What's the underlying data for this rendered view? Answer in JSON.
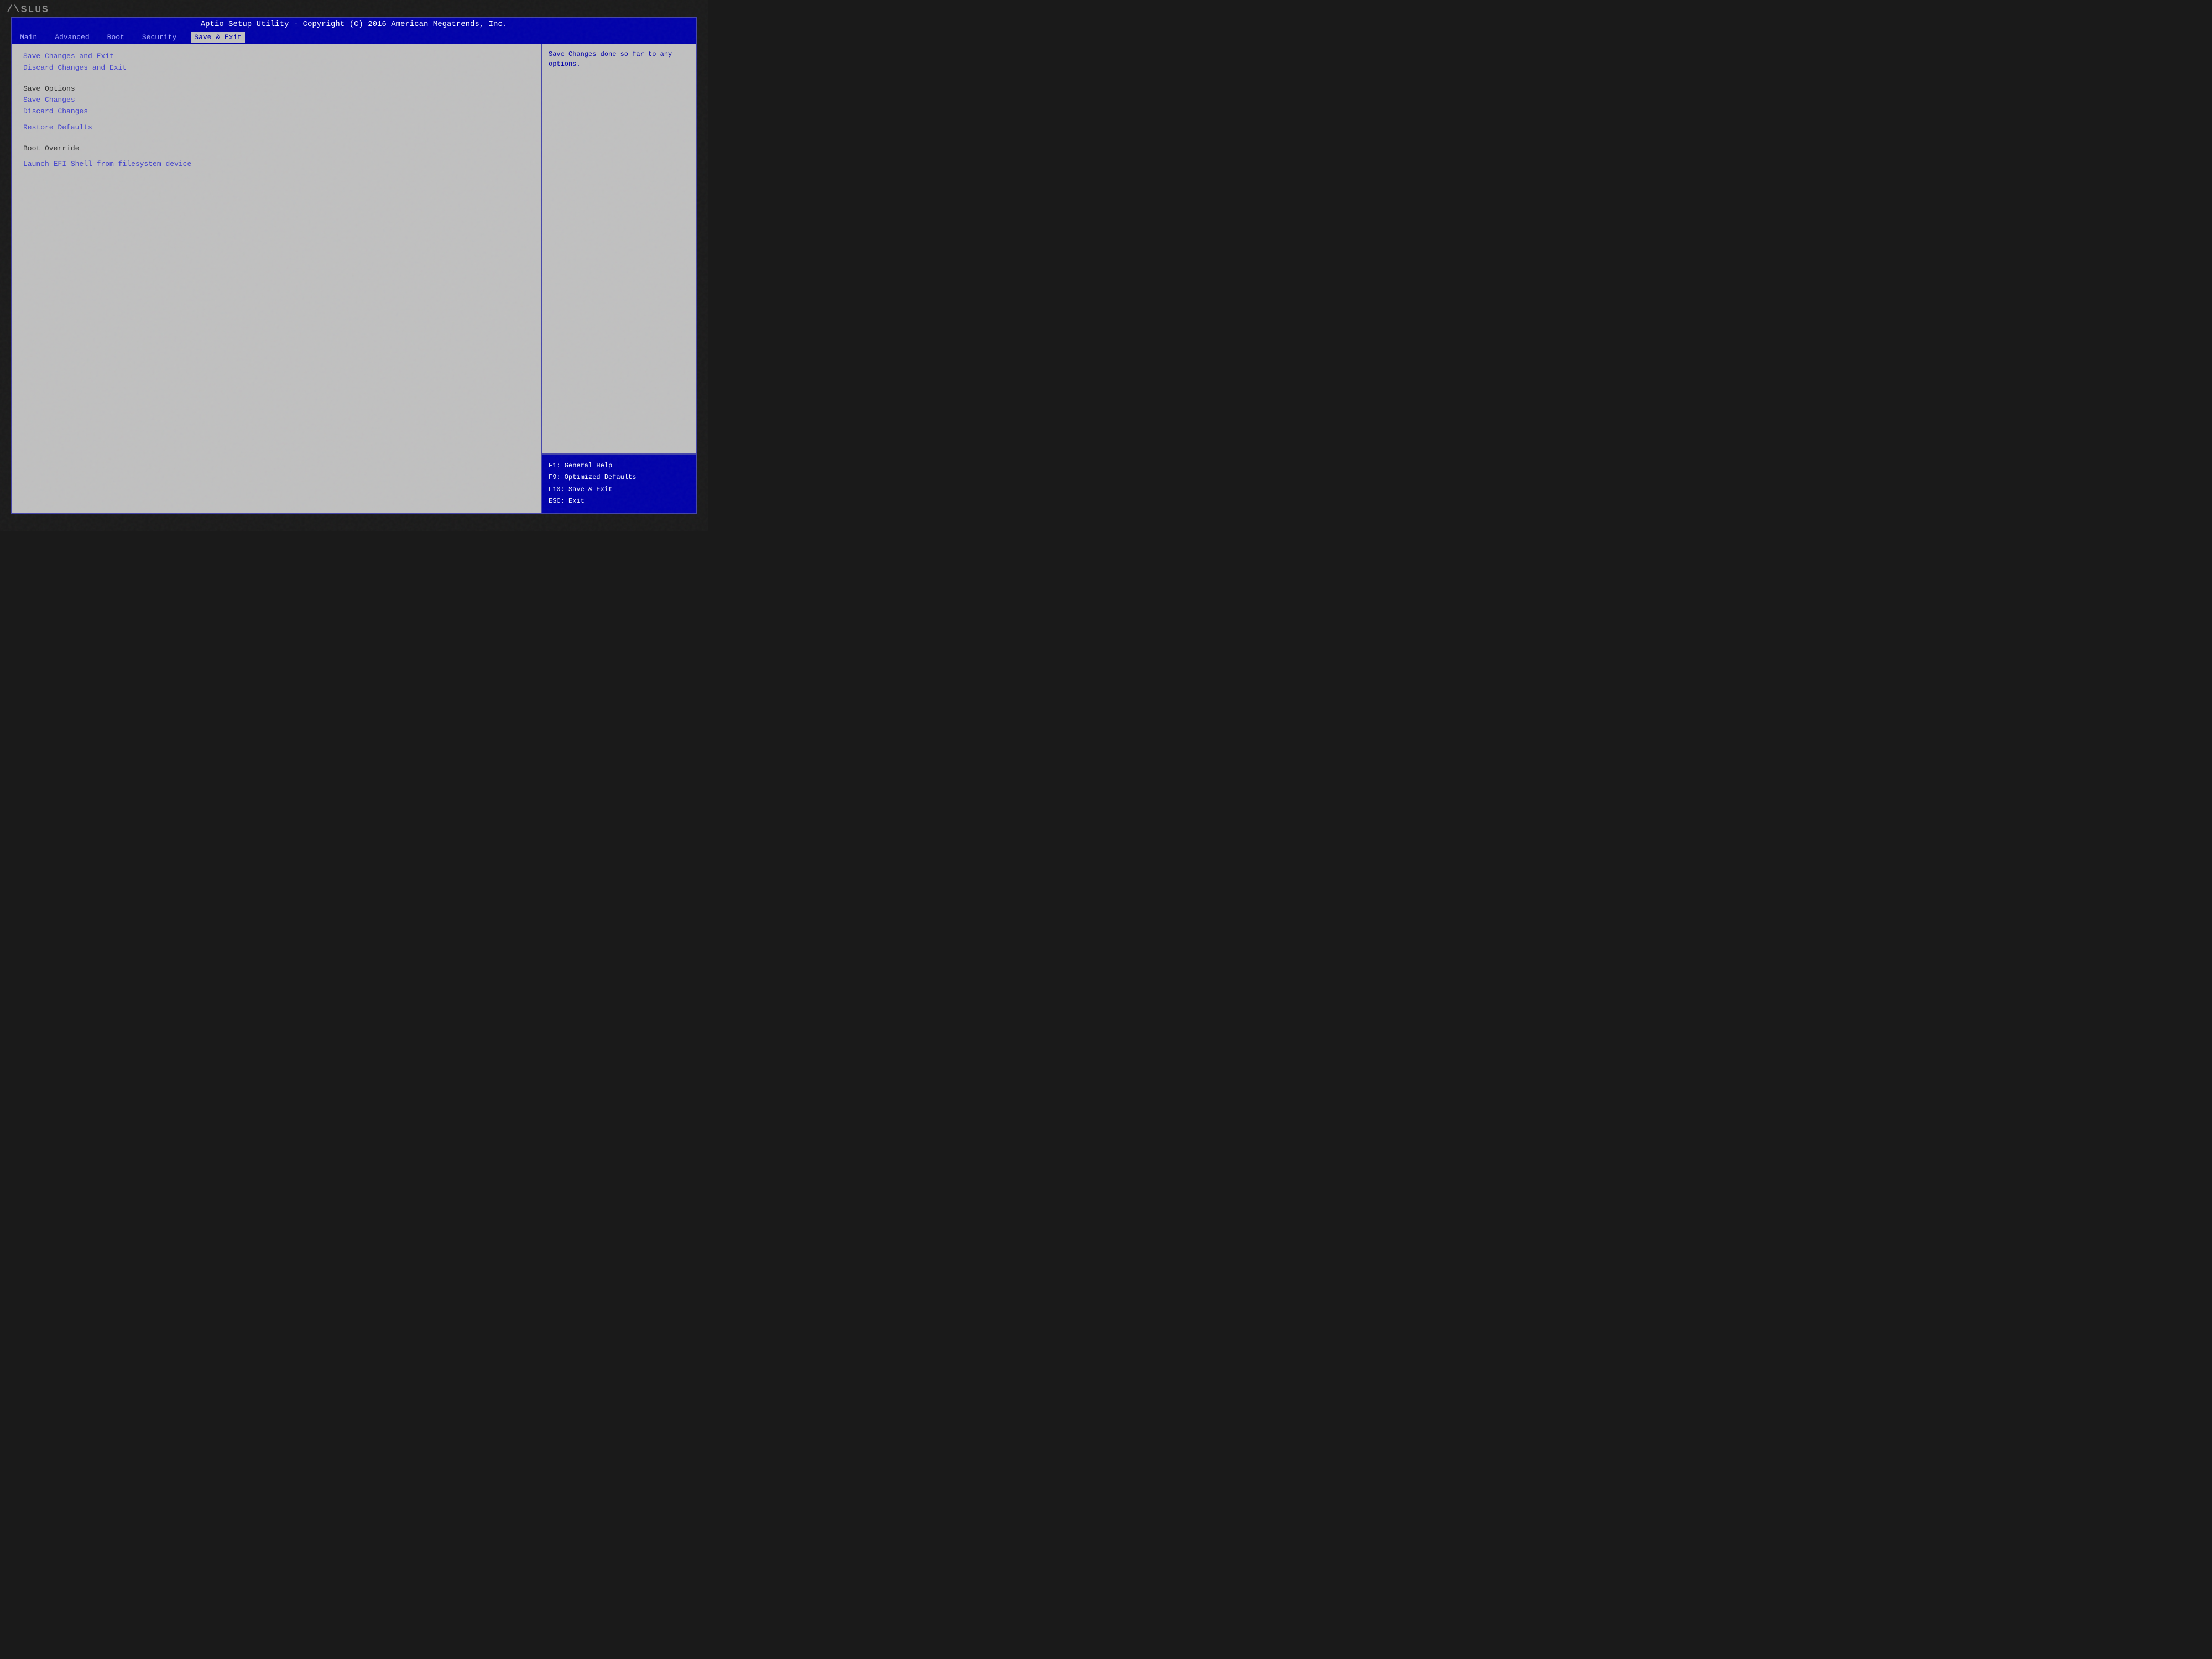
{
  "logo": {
    "text": "/\\SLUS"
  },
  "title_bar": {
    "text": "Aptio Setup Utility - Copyright (C) 2016 American Megatrends, Inc."
  },
  "menu": {
    "items": [
      {
        "id": "main",
        "label": "Main",
        "active": false
      },
      {
        "id": "advanced",
        "label": "Advanced",
        "active": false
      },
      {
        "id": "boot",
        "label": "Boot",
        "active": false
      },
      {
        "id": "security",
        "label": "Security",
        "active": false
      },
      {
        "id": "save-exit",
        "label": "Save & Exit",
        "active": true
      }
    ]
  },
  "left_panel": {
    "options": [
      {
        "id": "save-changes-exit",
        "label": "Save Changes and Exit",
        "type": "link"
      },
      {
        "id": "discard-changes-exit",
        "label": "Discard Changes and Exit",
        "type": "link"
      },
      {
        "id": "save-options-label",
        "label": "Save Options",
        "type": "section"
      },
      {
        "id": "save-changes",
        "label": "Save Changes",
        "type": "link"
      },
      {
        "id": "discard-changes",
        "label": "Discard Changes",
        "type": "link"
      },
      {
        "id": "restore-defaults",
        "label": "Restore Defaults",
        "type": "link"
      },
      {
        "id": "boot-override-label",
        "label": "Boot Override",
        "type": "section"
      },
      {
        "id": "launch-efi-shell",
        "label": "Launch EFI Shell from filesystem device",
        "type": "link"
      }
    ]
  },
  "right_panel": {
    "help_text": "Save Changes done so far to any\noptions.",
    "shortcuts": [
      {
        "key": "F1",
        "action": "General Help"
      },
      {
        "key": "F9",
        "action": "Optimized Defaults"
      },
      {
        "key": "F10",
        "action": "Save & Exit"
      },
      {
        "key": "ESC",
        "action": "Exit"
      }
    ]
  }
}
